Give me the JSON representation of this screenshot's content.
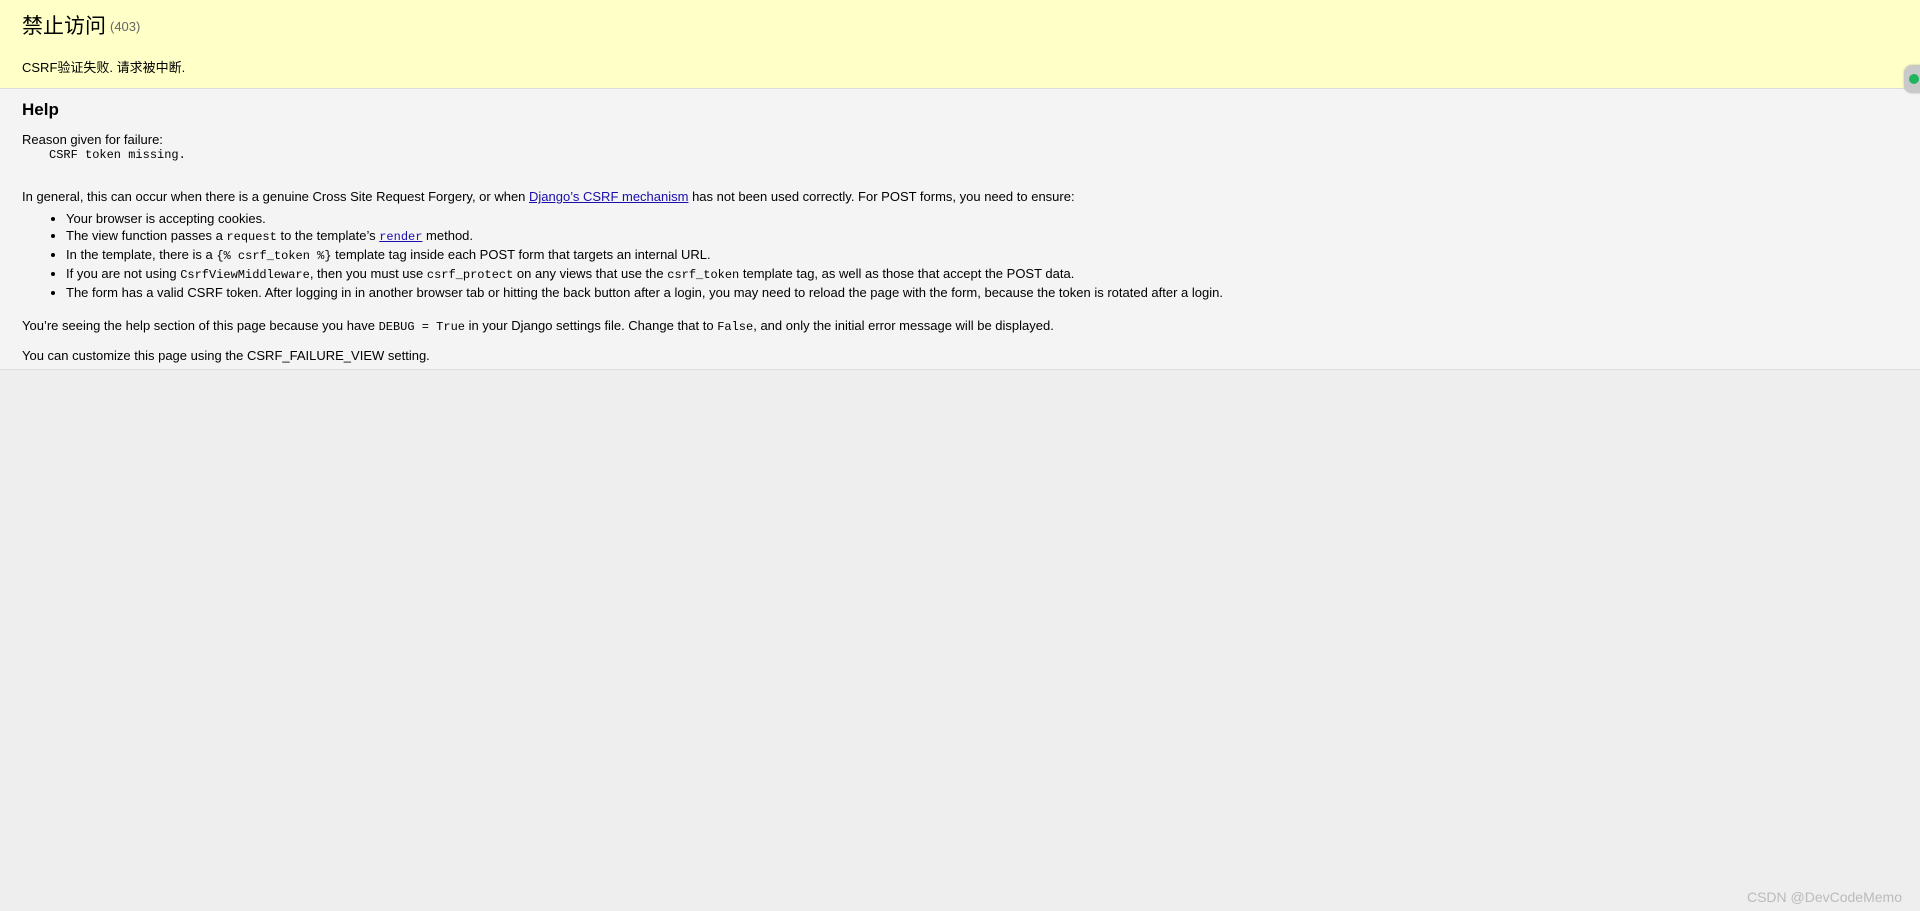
{
  "summary": {
    "title": "禁止访问",
    "code": "(403)",
    "message": "CSRF验证失败. 请求被中断."
  },
  "help": {
    "heading": "Help",
    "reason_label": "Reason given for failure:",
    "reason": "CSRF token missing.",
    "general_pre": "In general, this can occur when there is a genuine Cross Site Request Forgery, or when ",
    "general_link": "Django’s CSRF mechanism",
    "general_post": " has not been used correctly. For POST forms, you need to ensure:",
    "items": {
      "i1": {
        "t1": "Your browser is accepting cookies."
      },
      "i2": {
        "t1": "The view function passes a ",
        "c1": "request",
        "t2": " to the template’s ",
        "link": "render",
        "t3": " method."
      },
      "i3": {
        "t1": "In the template, there is a ",
        "c1": "{% csrf_token %}",
        "t2": " template tag inside each POST form that targets an internal URL."
      },
      "i4": {
        "t1": "If you are not using ",
        "c1": "CsrfViewMiddleware",
        "t2": ", then you must use ",
        "c2": "csrf_protect",
        "t3": " on any views that use the ",
        "c3": "csrf_token",
        "t4": " template tag, as well as those that accept the POST data."
      },
      "i5": {
        "t1": "The form has a valid CSRF token. After logging in in another browser tab or hitting the back button after a login, you may need to reload the page with the form, because the token is rotated after a login."
      }
    },
    "debug_note": {
      "t1": "You’re seeing the help section of this page because you have ",
      "c1": "DEBUG = True",
      "t2": " in your Django settings file. Change that to ",
      "c2": "False",
      "t3": ", and only the initial error message will be displayed."
    },
    "custom_note": "You can customize this page using the CSRF_FAILURE_VIEW setting."
  },
  "watermark": "CSDN @DevCodeMemo",
  "colors": {
    "summary_bg": "#ffffc8",
    "info_bg": "#f4f4f4",
    "page_bg": "#eeeeee",
    "link": "#1a0dab",
    "status_dot": "#22b35e"
  },
  "icons": {
    "corner_widget": "status-dot-icon"
  }
}
